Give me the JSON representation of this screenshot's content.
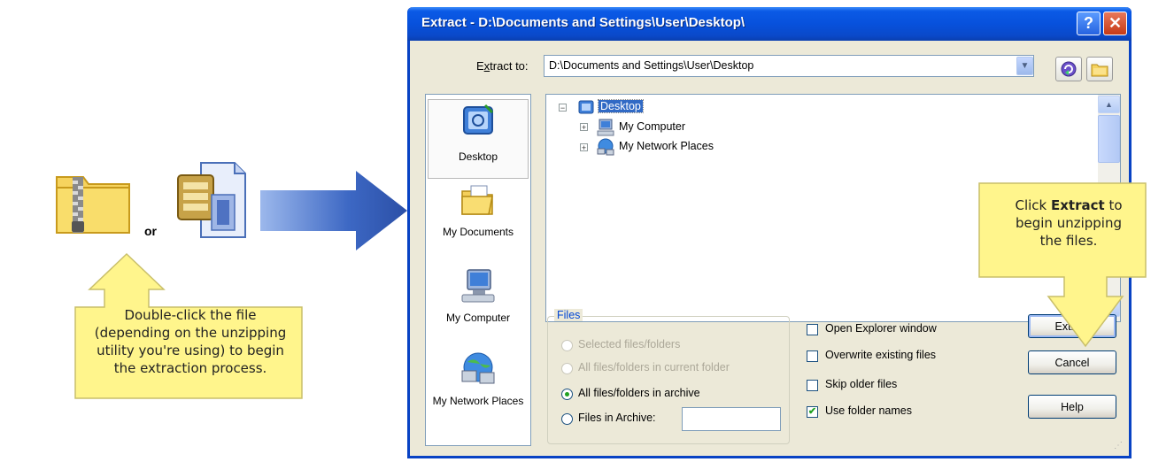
{
  "illustration": {
    "or_label": "or",
    "callout_left_lines": [
      "Double-click the file",
      "(depending on the unzipping",
      "utility you're using) to begin",
      "the extraction process."
    ],
    "callout_right_lines": [
      "Click Extract to",
      "begin unzipping",
      "the files."
    ],
    "callout_right_bold": "Extract",
    "callout_color": "#fff58c"
  },
  "dialog": {
    "title": "Extract - D:\\Documents and Settings\\User\\Desktop\\",
    "help_glyph": "?",
    "close_glyph": "✕",
    "extract_to_label": "Extract to:",
    "path_value": "D:\\Documents and Settings\\User\\Desktop",
    "places": [
      "Desktop",
      "My Documents",
      "My Computer",
      "My Network Places"
    ],
    "tree": {
      "root": "Desktop",
      "children": [
        "My Computer",
        "My Network Places"
      ]
    },
    "files_group": {
      "legend": "Files",
      "options": [
        {
          "label": "Selected files/folders",
          "enabled": false,
          "checked": false
        },
        {
          "label": "All files/folders in current folder",
          "enabled": false,
          "checked": false
        },
        {
          "label": "All files/folders in archive",
          "enabled": true,
          "checked": true
        },
        {
          "label": "Files in Archive:",
          "enabled": true,
          "checked": false
        }
      ],
      "archive_filter_value": ""
    },
    "checkboxes": [
      {
        "label": "Open Explorer window",
        "checked": false
      },
      {
        "label": "Overwrite existing files",
        "checked": false
      },
      {
        "label": "Skip older files",
        "checked": false
      },
      {
        "label": "Use folder names",
        "checked": true
      }
    ],
    "buttons": {
      "extract": "Extract",
      "cancel": "Cancel",
      "help": "Help"
    },
    "colors": {
      "titlebar": "#0751dc",
      "dialog_bg": "#ece9d8",
      "selection": "#316ac5",
      "accent_arrow": "#2f5bb7"
    }
  }
}
